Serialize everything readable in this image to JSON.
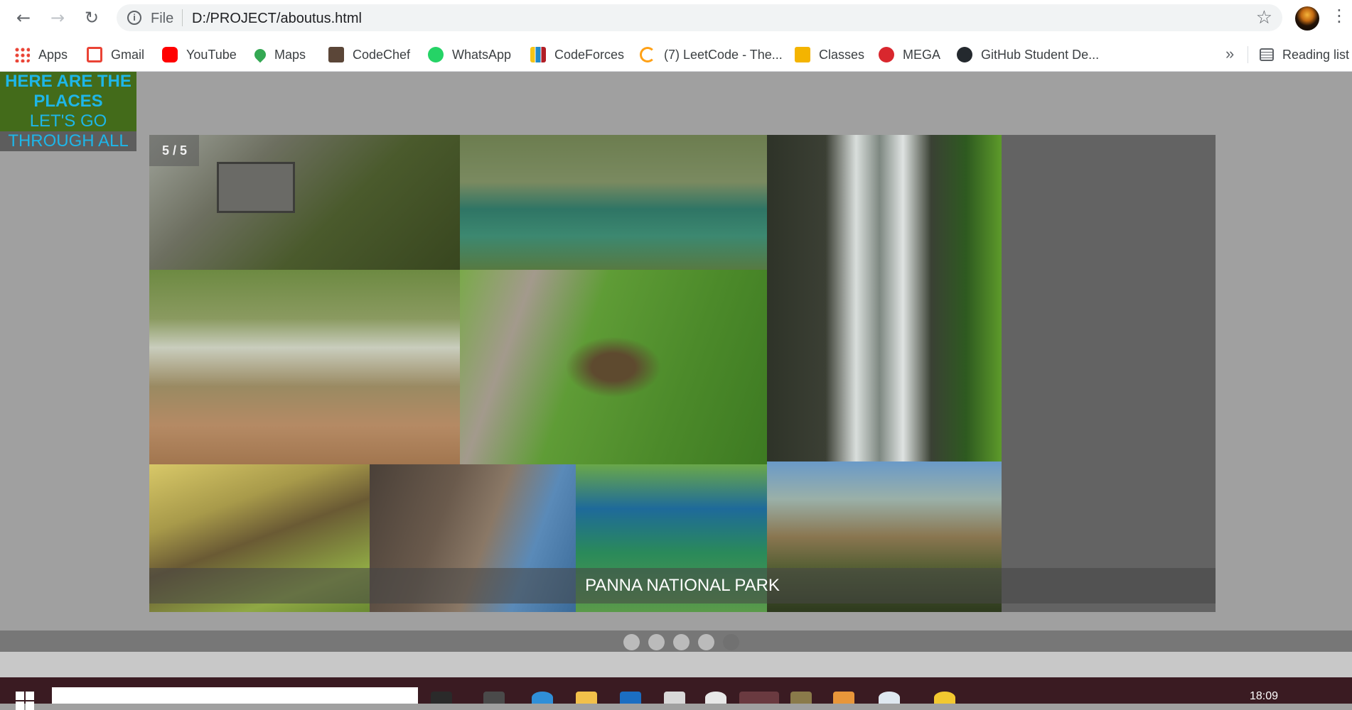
{
  "browser": {
    "scheme": "File",
    "url": "D:/PROJECT/aboutus.html",
    "back_icon": "←",
    "forward_icon": "→",
    "reload_icon": "↻",
    "star_icon": "☆",
    "menu_icon": "⋮",
    "info_icon": "i"
  },
  "bookmarks": {
    "items": [
      {
        "label": "Apps",
        "color": "#4285f4"
      },
      {
        "label": "Gmail",
        "color": "#ea4335"
      },
      {
        "label": "YouTube",
        "color": "#ff0000"
      },
      {
        "label": "Maps",
        "color": "#34a853"
      },
      {
        "label": "CodeChef",
        "color": "#5b4638"
      },
      {
        "label": "WhatsApp",
        "color": "#25d366"
      },
      {
        "label": "CodeForces",
        "color": "#1f8acb"
      },
      {
        "label": "(7) LeetCode - The...",
        "color": "#ffa116"
      },
      {
        "label": "Classes",
        "color": "#f4b400"
      },
      {
        "label": "MEGA",
        "color": "#d9272e"
      },
      {
        "label": "GitHub Student De...",
        "color": "#24292e"
      }
    ],
    "more": "»",
    "reading_list": "Reading list"
  },
  "page": {
    "heading_line1": "HERE ARE THE",
    "heading_line2": "PLACES",
    "heading_line3": "LET'S GO",
    "heading_line4": "THROUGH ALL"
  },
  "slideshow": {
    "number_text": "5 / 5",
    "caption": "PANNA NATIONAL PARK",
    "slide_count": 5,
    "active_index": 5
  },
  "taskbar": {
    "time": "18:09"
  }
}
